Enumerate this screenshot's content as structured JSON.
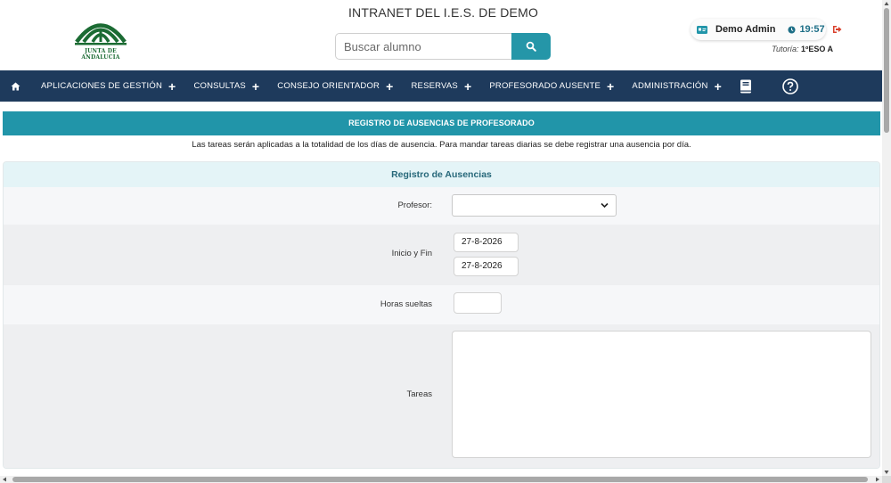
{
  "header": {
    "logo_text": "JUNTA DE ANDALUCIA",
    "site_title": "INTRANET DEL I.E.S. DE DEMO",
    "search_placeholder": "Buscar alumno",
    "user_name": "Demo Admin",
    "time": "19:57",
    "tutoria_label": "Tutoría:",
    "tutoria_value": "1ºESO A"
  },
  "nav": {
    "items": [
      {
        "label": "APLICACIONES DE GESTIÓN",
        "plus": "+"
      },
      {
        "label": "CONSULTAS",
        "plus": "+"
      },
      {
        "label": "CONSEJO ORIENTADOR",
        "plus": "+"
      },
      {
        "label": "RESERVAS",
        "plus": "+"
      },
      {
        "label": "PROFESORADO AUSENTE",
        "plus": "+"
      },
      {
        "label": "ADMINISTRACIÓN",
        "plus": "+"
      }
    ]
  },
  "page": {
    "banner": "REGISTRO DE AUSENCIAS DE PROFESORADO",
    "notice": "Las tareas serán aplicadas a la totalidad de los días de ausencia. Para mandar tareas diarias se debe registrar una ausencia por día.",
    "card_title": "Registro de Ausencias"
  },
  "form": {
    "profesor_label": "Profesor:",
    "profesor_value": "",
    "dates_label": "Inicio y Fin",
    "start_date": "27-8-2026",
    "end_date": "27-8-2026",
    "hours_label": "Horas sueltas",
    "hours_value": "",
    "tasks_label": "Tareas",
    "tasks_value": ""
  },
  "colors": {
    "nav_bg": "#1e3a5c",
    "accent": "#2195a9",
    "brand_green": "#1b6b33",
    "logout_red": "#d9402c"
  },
  "icons": {
    "home": "home-icon",
    "search": "search-icon",
    "user_card": "id-card-icon",
    "clock": "clock-icon",
    "logout": "logout-icon",
    "book": "book-icon",
    "help": "help-circle-icon"
  }
}
